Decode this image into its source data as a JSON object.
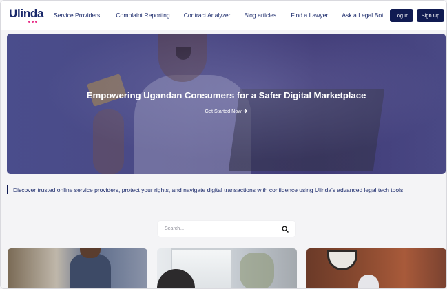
{
  "brand": {
    "name": "Ulinda",
    "accent": "#e8338a",
    "navy": "#101b52"
  },
  "nav": {
    "items": [
      "Service Providers",
      "Complaint Reporting",
      "Contract Analyzer",
      "Blog articles",
      "Find a Lawyer",
      "Ask a Legal Bot"
    ],
    "login_label": "Log In",
    "signup_label": "Sign Up"
  },
  "hero": {
    "title": "Empowering Ugandan Consumers for a Safer Digital Marketplace",
    "cta_label": "Get Started Now",
    "cta_icon": "arrow-right-icon"
  },
  "tagline": "Discover trusted online service providers, protect your rights, and navigate digital transactions with confidence using Ulinda's advanced legal tech tools.",
  "search": {
    "placeholder": "Search...",
    "icon": "search-icon"
  },
  "cards": [
    "provider-card-1",
    "provider-card-2",
    "provider-card-3"
  ]
}
